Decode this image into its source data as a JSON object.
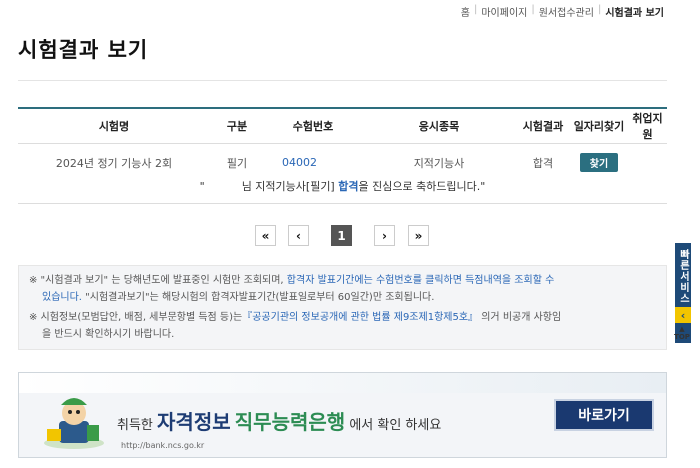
{
  "breadcrumb": [
    "홈",
    "마이페이지",
    "원서접수관리",
    "시험결과 보기"
  ],
  "page_title": "시험결과 보기",
  "table": {
    "headers": [
      "시험명",
      "구분",
      "수험번호",
      "응시종목",
      "시험결과",
      "일자리찾기",
      "취업지원"
    ],
    "row": {
      "exam": "2024년 정기 기능사 2회",
      "type": "필기",
      "number": "04002",
      "subject": "지적기능사",
      "result": "합격",
      "job_button": "찾기",
      "support": ""
    }
  },
  "congrats": {
    "prefix": "\"",
    "mid": "님 지적기능사[필기]",
    "highlight": "합격",
    "suffix": "을 진심으로 축하드립니다.\""
  },
  "pagination": {
    "first": "«",
    "prev": "‹",
    "current": "1",
    "next": "›",
    "last": "»"
  },
  "notice": {
    "line1_a": "※ \"시험결과 보기\" 는 당해년도에 발표중인 시험만 조회되며,",
    "line1_b": "합격자 발표기간에는 수험번호를 클릭하면 득점내역을 조회할 수",
    "line1_c": "있습니다.",
    "line1_d": "\"시험결과보기\"는 해당시험의 합격자발표기간(발표일로부터 60일간)만 조회됩니다.",
    "line2_a": "※ 시험정보(모범답안, 배점, 세부문항별 득점 등)는",
    "line2_b": "『공공기관의 정보공개에 관한 법률 제9조제1항제5호』",
    "line2_c": "의거 비공개 사항임",
    "line2_d": "을 반드시 확인하시기 바랍니다."
  },
  "banner": {
    "pre": "취득한",
    "brand1": "자격정보",
    "brand2": "직무능력은행",
    "post": "에서 확인 하세요",
    "url": "http://bank.ncs.go.kr",
    "button": "바로가기"
  },
  "side": {
    "quick": "빠른서비스",
    "arrow": "‹",
    "top": "TOP"
  }
}
